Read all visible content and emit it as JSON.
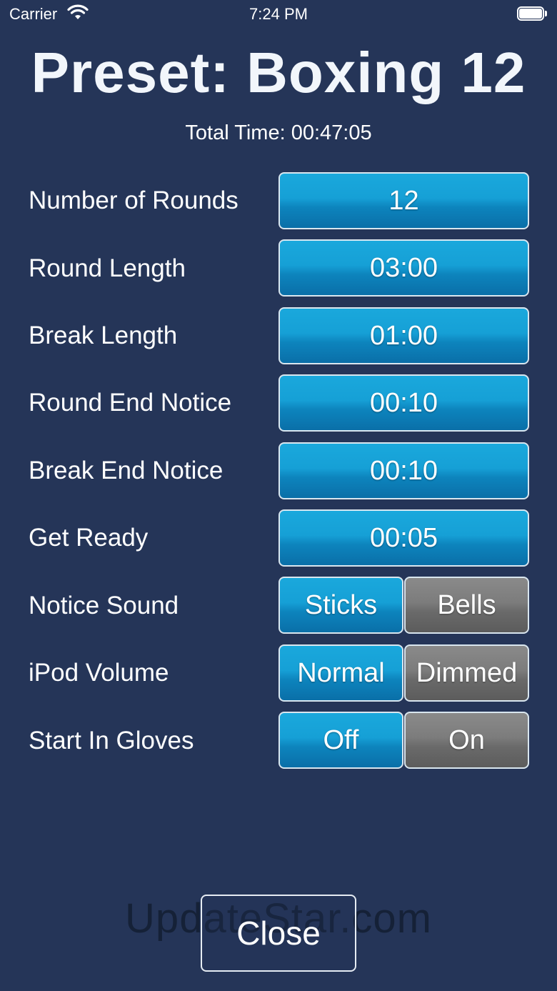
{
  "status_bar": {
    "carrier": "Carrier",
    "time": "7:24 PM",
    "wifi_icon": "wifi-icon",
    "battery_icon": "battery-icon"
  },
  "header": {
    "title": "Preset: Boxing 12",
    "total_time": "Total Time: 00:47:05"
  },
  "settings": {
    "number_of_rounds": {
      "label": "Number of Rounds",
      "value": "12"
    },
    "round_length": {
      "label": "Round Length",
      "value": "03:00"
    },
    "break_length": {
      "label": "Break Length",
      "value": "01:00"
    },
    "round_end_notice": {
      "label": "Round End Notice",
      "value": "00:10"
    },
    "break_end_notice": {
      "label": "Break End Notice",
      "value": "00:10"
    },
    "get_ready": {
      "label": "Get Ready",
      "value": "00:05"
    },
    "notice_sound": {
      "label": "Notice Sound",
      "options": [
        "Sticks",
        "Bells"
      ],
      "selected": "Sticks"
    },
    "ipod_volume": {
      "label": "iPod Volume",
      "options": [
        "Normal",
        "Dimmed"
      ],
      "selected": "Normal"
    },
    "start_in_gloves": {
      "label": "Start In Gloves",
      "options": [
        "Off",
        "On"
      ],
      "selected": "Off"
    }
  },
  "watermark": "UpdateStar.com",
  "close_label": "Close",
  "colors": {
    "background": "#253558",
    "selected": "#16a0d6",
    "unselected": "#7c7c7c"
  }
}
